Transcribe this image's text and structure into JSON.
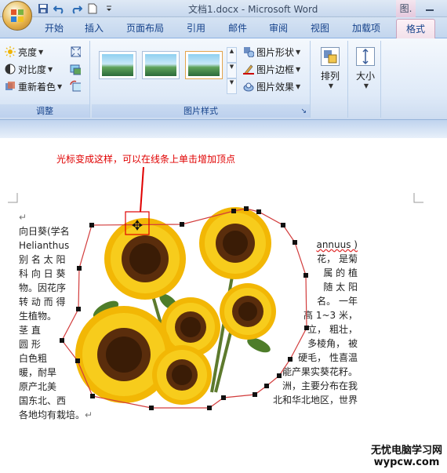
{
  "window": {
    "title": "文档1.docx - Microsoft Word",
    "context_tab_header": "图."
  },
  "tabs": [
    "开始",
    "插入",
    "页面布局",
    "引用",
    "邮件",
    "审阅",
    "视图",
    "加载项",
    "格式"
  ],
  "ribbon": {
    "adjust": {
      "label": "调整",
      "brightness": "亮度",
      "contrast": "对比度",
      "recolor": "重新着色"
    },
    "picture_styles": {
      "label": "图片样式",
      "shape": "图片形状",
      "border": "图片边框",
      "effects": "图片效果"
    },
    "arrange": {
      "label": "排列"
    },
    "size": {
      "label": "大小"
    }
  },
  "annotation": "光标变成这样，可以在线条上单击增加顶点",
  "document": {
    "left_lines": [
      "向日葵(学名",
      "Helianthus",
      "别 名 太 阳",
      "科 向 日 葵",
      "物。因花序",
      "转 动 而 得",
      "生植物。",
      "茎  直",
      "圆  形",
      "白色粗",
      "暖，耐旱",
      "原产北美",
      "国东北、西",
      "各地均有栽培。"
    ],
    "right_lines": [
      "annuus  )",
      "花， 是菊",
      "属 的 植",
      "随 太 阳",
      "名。 一年",
      "高 1~3 米，",
      "立， 粗壮，",
      "多棱角， 被",
      "硬毛， 性喜温",
      "能产果实葵花籽。",
      "洲，主要分布在我",
      "北和华北地区，世界"
    ],
    "para_mark": "↵"
  },
  "watermark": {
    "line1": "无忧电脑学习网",
    "line2": "wypcw.com"
  },
  "colors": {
    "annotation": "#e00000",
    "wrap_outline": "#d23c3c",
    "vertex": "#111111"
  }
}
